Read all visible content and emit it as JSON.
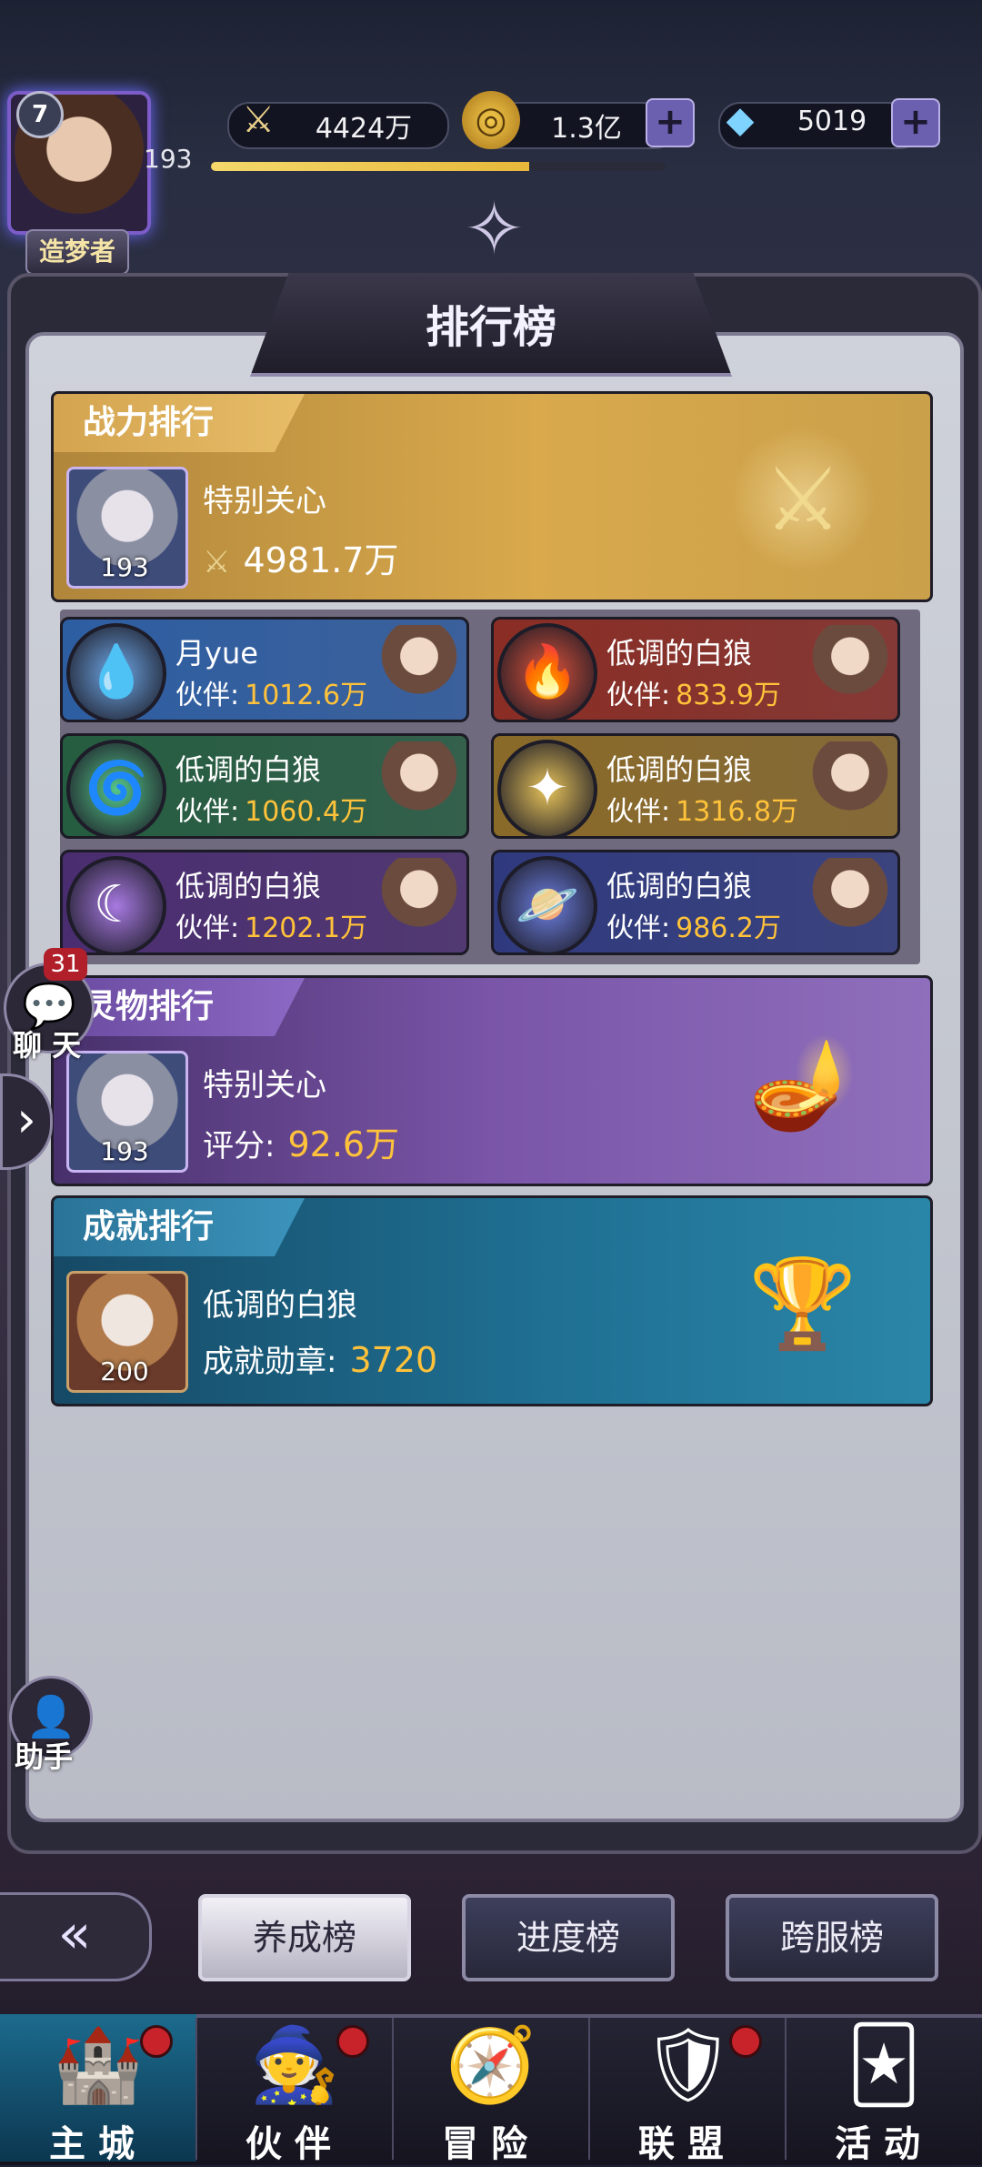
{
  "player": {
    "avatar_level": "7",
    "level": "193",
    "title": "造梦者",
    "title_stars": "◆◆◆◆◆",
    "xp_progress": 0.7
  },
  "resources": {
    "power_value": "4424万",
    "gold_value": "1.3亿",
    "diamond_value": "5019",
    "plus_label": "+"
  },
  "panel": {
    "title": "排行榜"
  },
  "power_rank": {
    "tab": "战力排行",
    "name": "特别关心",
    "avatar_level": "193",
    "value": "4981.7万"
  },
  "element_ranks": [
    {
      "element": "water-icon",
      "glyph": "💧",
      "name": "月yue",
      "partner_label": "伙伴:",
      "value": "1012.6万",
      "color": "#2e5ea2",
      "icon_bg": "#6ea8e8"
    },
    {
      "element": "fire-icon",
      "glyph": "🔥",
      "name": "低调的白狼",
      "partner_label": "伙伴:",
      "value": "833.9万",
      "color": "#8a2d24",
      "icon_bg": "#e0533b"
    },
    {
      "element": "wind-icon",
      "glyph": "🌀",
      "name": "低调的白狼",
      "partner_label": "伙伴:",
      "value": "1060.4万",
      "color": "#255d40",
      "icon_bg": "#55c78b"
    },
    {
      "element": "light-icon",
      "glyph": "✦",
      "name": "低调的白狼",
      "partner_label": "伙伴:",
      "value": "1316.8万",
      "color": "#8a6a28",
      "icon_bg": "#e6c25a"
    },
    {
      "element": "dark-icon",
      "glyph": "☾",
      "name": "低调的白狼",
      "partner_label": "伙伴:",
      "value": "1202.1万",
      "color": "#4a2d70",
      "icon_bg": "#a679e0"
    },
    {
      "element": "cosmic-icon",
      "glyph": "🪐",
      "name": "低调的白狼",
      "partner_label": "伙伴:",
      "value": "986.2万",
      "color": "#2f3a7e",
      "icon_bg": "#6c7fe0"
    }
  ],
  "spirit_rank": {
    "tab": "灵物排行",
    "name": "特别关心",
    "avatar_level": "193",
    "stat_label": "评分:",
    "value": "92.6万"
  },
  "achievement_rank": {
    "tab": "成就排行",
    "name": "低调的白狼",
    "avatar_level": "200",
    "stat_label": "成就勋章:",
    "value": "3720"
  },
  "side": {
    "chat_count": "31",
    "chat_label": "聊 天",
    "helper_label": "助手"
  },
  "sub_tabs": [
    "养成榜",
    "进度榜",
    "跨服榜"
  ],
  "nav": [
    {
      "label": "主城",
      "icon": "castle-icon",
      "glyph": "🏰",
      "dot": true,
      "active": true
    },
    {
      "label": "伙伴",
      "icon": "partner-icon",
      "glyph": "🧙",
      "dot": true,
      "active": false
    },
    {
      "label": "冒险",
      "icon": "adventure-icon",
      "glyph": "🧭",
      "dot": false,
      "active": false
    },
    {
      "label": "联盟",
      "icon": "alliance-icon",
      "glyph": "🛡",
      "dot": true,
      "active": false
    },
    {
      "label": "活动",
      "icon": "event-icon",
      "glyph": "🃏",
      "dot": false,
      "active": false
    }
  ],
  "colors": {
    "gold_value": "#ffc23a",
    "notification": "#c8232b"
  }
}
